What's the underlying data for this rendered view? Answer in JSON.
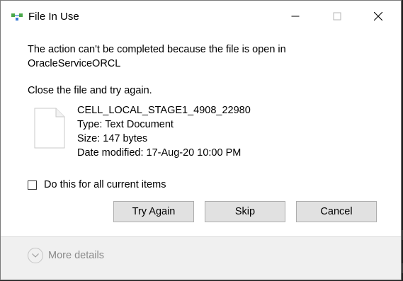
{
  "window": {
    "title": "File In Use",
    "icon": "file-in-use-icon",
    "controls": [
      "minimize-icon",
      "maximize-icon",
      "close-icon"
    ]
  },
  "message": {
    "line1": "The action can't be completed because the file is open in OracleServiceORCL",
    "line2": "Close the file and try again."
  },
  "file": {
    "icon": "text-document-icon",
    "name": "CELL_LOCAL_STAGE1_4908_22980",
    "type": "Type: Text Document",
    "size": "Size: 147 bytes",
    "date_modified": "Date modified: 17-Aug-20 10:00 PM"
  },
  "checkbox": {
    "label": "Do this for all current items",
    "checked": false
  },
  "buttons": {
    "try_again": "Try Again",
    "skip": "Skip",
    "cancel": "Cancel"
  },
  "details": {
    "label": "More details",
    "icon": "chevron-down-icon"
  },
  "colors": {
    "dialog_bg": "#ffffff",
    "footer_bg": "#f0f0f0",
    "button_bg": "#e1e1e1",
    "button_border": "#adadad",
    "icon_green": "#4aa84a",
    "icon_blue": "#3a7bd5"
  }
}
